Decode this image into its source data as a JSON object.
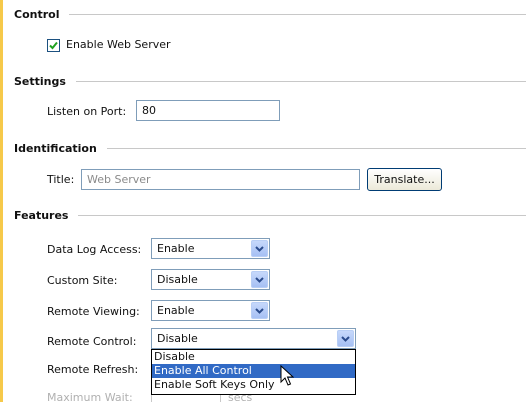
{
  "sections": {
    "control": {
      "title": "Control",
      "enable_web_server": {
        "label": "Enable Web Server",
        "checked": true
      }
    },
    "settings": {
      "title": "Settings",
      "listen_port": {
        "label": "Listen on Port:",
        "value": "80"
      }
    },
    "identification": {
      "title": "Identification",
      "title_field": {
        "label": "Title:",
        "placeholder": "Web Server"
      },
      "translate_button": "Translate..."
    },
    "features": {
      "title": "Features",
      "data_log_access": {
        "label": "Data Log Access:",
        "value": "Enable"
      },
      "custom_site": {
        "label": "Custom Site:",
        "value": "Disable"
      },
      "remote_viewing": {
        "label": "Remote Viewing:",
        "value": "Enable"
      },
      "remote_control": {
        "label": "Remote Control:",
        "value": "Disable",
        "options": [
          "Disable",
          "Enable All Control",
          "Enable Soft Keys Only"
        ],
        "highlighted_option": "Enable All Control"
      },
      "remote_refresh": {
        "label": "Remote Refresh:"
      },
      "maximum_wait": {
        "label": "Maximum Wait:",
        "unit": "secs"
      }
    }
  },
  "icons": {
    "check": "checkmark-icon",
    "dropdown_arrow": "chevron-down-icon",
    "cursor": "mouse-pointer-icon"
  },
  "colors": {
    "window_frame": "#f6c94a",
    "highlight": "#316ac5",
    "checkmark": "#21a121",
    "dropdown_button": "#a6c0f4"
  }
}
